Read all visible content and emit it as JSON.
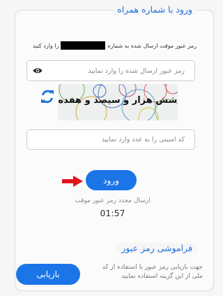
{
  "login_section": {
    "title": "ورود با شماره همراه",
    "info_before": "رمز عبور موقت ارسال شده به شماره",
    "info_after": "را وارد کنید",
    "password_placeholder": "رمز عبور ارسال شده را وارد نمایید",
    "captcha_text": "شش هزار و سیصد و هفده",
    "captcha_placeholder": "کد امنیتی را به عدد وارد نمایید",
    "login_label": "ورود",
    "resend_label": "ارسال مجدد رمز عبور موقت",
    "timer": "01:57"
  },
  "forgot_section": {
    "title": "فراموشی رمز عبور",
    "description": "جهت بازیابی رمز عبور با استفاده از کد ملی از این گزینه استفاده نمایید",
    "reset_label": "بازیابی"
  },
  "colors": {
    "accent": "#1b75e6",
    "arrow": "#e0151c"
  },
  "icons": {
    "eye": "eye-icon",
    "refresh": "refresh-icon",
    "arrow": "arrow-right-icon"
  }
}
